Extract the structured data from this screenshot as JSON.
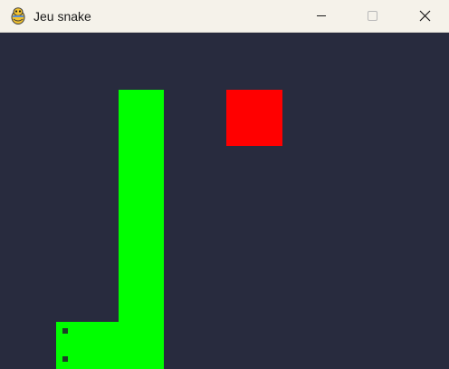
{
  "window": {
    "title": "Jeu snake",
    "app_icon": "pygame-snake-icon",
    "controls": {
      "minimize_icon": "minimize-icon",
      "maximize_icon": "maximize-icon",
      "close_icon": "close-icon"
    }
  },
  "game": {
    "background_color": "#282b3e",
    "snake_color": "#00ff00",
    "food_color": "#ff0000",
    "snake_eye_color": "#1e3d28"
  }
}
